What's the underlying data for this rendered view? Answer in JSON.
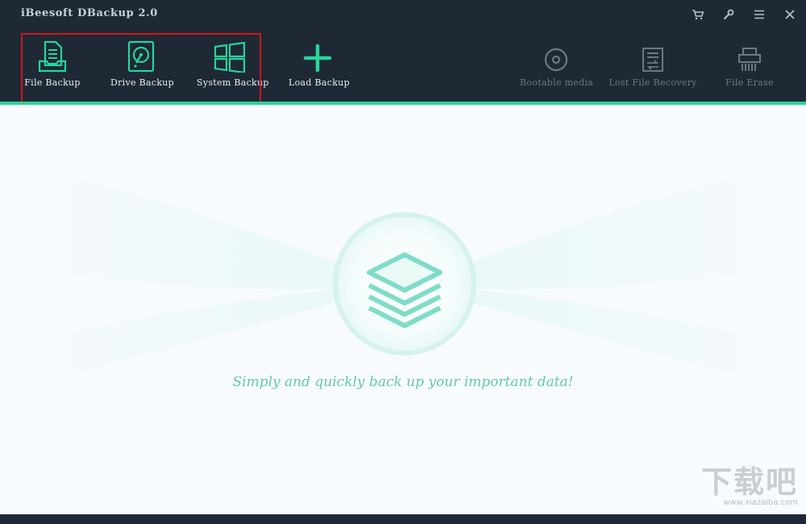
{
  "app": {
    "title": "iBeesoft DBackup 2.0"
  },
  "window_controls": [
    {
      "name": "cart-icon"
    },
    {
      "name": "key-icon"
    },
    {
      "name": "menu-icon"
    },
    {
      "name": "close-icon"
    }
  ],
  "toolbar": {
    "file_backup": "File Backup",
    "drive_backup": "Drive Backup",
    "system_backup": "System Backup",
    "load_backup": "Load Backup",
    "bootable_media": "Bootable media",
    "lost_file_recovery": "Lost File Recovery",
    "file_erase": "File Erase"
  },
  "main": {
    "tagline": "Simply and quickly back up your important data!"
  },
  "watermark": {
    "big": "下载吧",
    "small": "www.xiazaiba.com"
  },
  "colors": {
    "accent": "#2ad39c",
    "toolbar_bg": "#1e2935",
    "content_bg": "#f7fbfd",
    "highlight": "#d0141a",
    "tagline": "#63c7b5"
  }
}
